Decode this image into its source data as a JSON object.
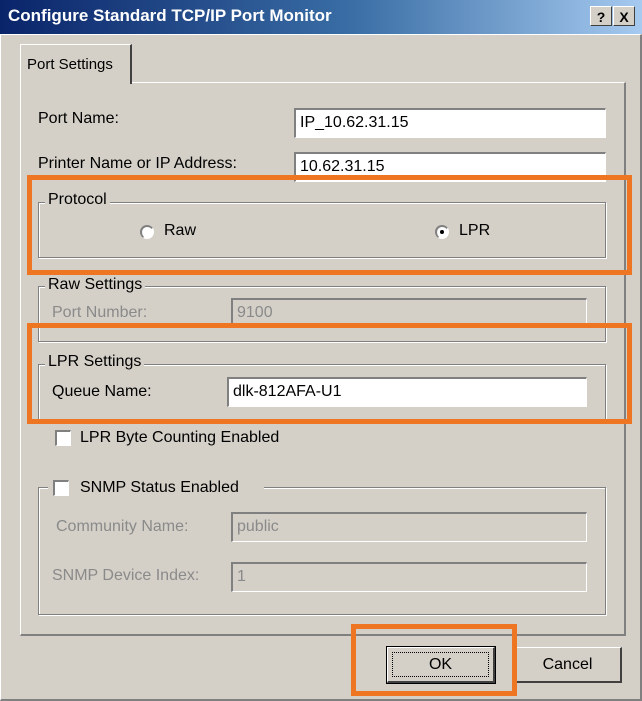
{
  "window": {
    "title": "Configure Standard TCP/IP Port Monitor",
    "help_glyph": "?",
    "close_glyph": "X"
  },
  "tabs": [
    {
      "label": "Port Settings",
      "selected": true
    }
  ],
  "port_settings": {
    "port_name_label": "Port Name:",
    "port_name_value": "IP_10.62.31.15",
    "printer_label": "Printer Name or IP Address:",
    "printer_value": "10.62.31.15"
  },
  "protocol": {
    "title": "Protocol",
    "raw_label": "Raw",
    "lpr_label": "LPR",
    "selected": "LPR"
  },
  "raw_settings": {
    "title": "Raw Settings",
    "port_number_label": "Port Number:",
    "port_number_value": "9100"
  },
  "lpr_settings": {
    "title": "LPR Settings",
    "queue_name_label": "Queue Name:",
    "queue_name_value": "dlk-812AFA-U1",
    "byte_counting_label": "LPR Byte Counting Enabled",
    "byte_counting_checked": false
  },
  "snmp": {
    "title": "SNMP Status Enabled",
    "enabled": false,
    "community_label": "Community Name:",
    "community_value": "public",
    "device_index_label": "SNMP Device Index:",
    "device_index_value": "1"
  },
  "buttons": {
    "ok_label": "OK",
    "cancel_label": "Cancel"
  },
  "highlight_color": "#ee7623"
}
